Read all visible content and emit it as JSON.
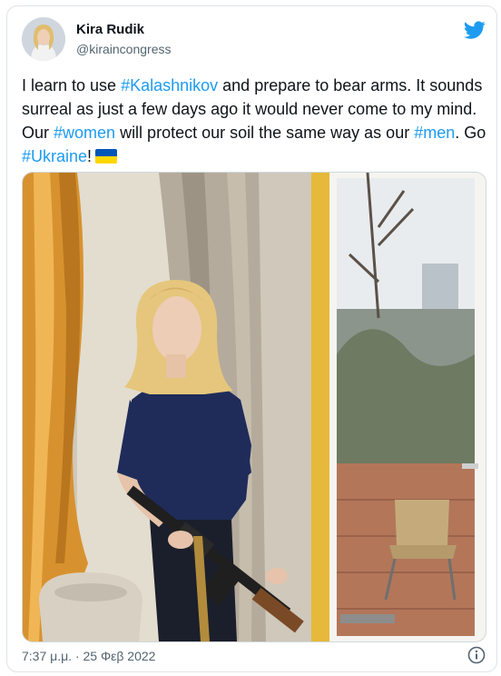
{
  "author": {
    "name": "Kira Rudik",
    "handle": "@kiraincongress"
  },
  "tweet": {
    "segments": [
      {
        "text": "I learn to use ",
        "type": "text"
      },
      {
        "text": "#Kalashnikov",
        "type": "hashtag"
      },
      {
        "text": " and prepare to bear arms. It sounds surreal as just a few days ago it would never come to my mind. Our ",
        "type": "text"
      },
      {
        "text": "#women",
        "type": "hashtag"
      },
      {
        "text": " will protect our soil the same way as our ",
        "type": "text"
      },
      {
        "text": "#men",
        "type": "hashtag"
      },
      {
        "text": ". Go ",
        "type": "text"
      },
      {
        "text": "#Ukraine",
        "type": "hashtag"
      },
      {
        "text": "!",
        "type": "text"
      }
    ],
    "emoji": "ukraine-flag"
  },
  "timestamp": "7:37 μ.μ. · 25 Φεβ 2022",
  "icons": {
    "brand": "twitter-bird-icon",
    "info": "info-icon"
  },
  "colors": {
    "accent": "#1d9bf0",
    "text": "#0f1419",
    "muted": "#536471",
    "flag_blue": "#0057b7",
    "flag_yellow": "#ffd700"
  }
}
